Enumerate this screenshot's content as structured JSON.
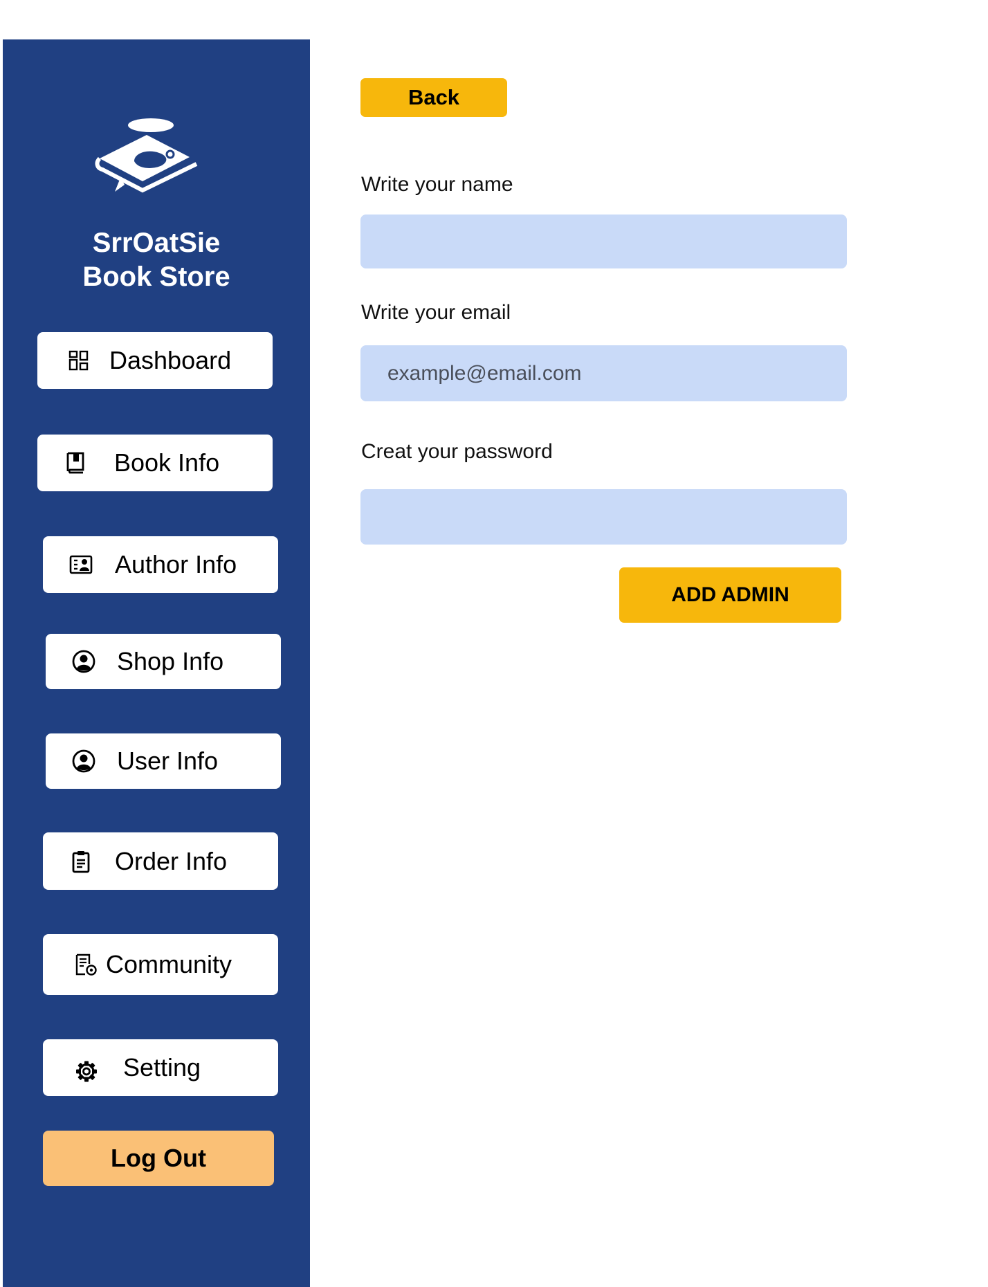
{
  "brand": {
    "line1": "SrrOatSie",
    "line2": "Book Store",
    "logo_icon": "book-with-cup-logo"
  },
  "sidebar": {
    "items": [
      {
        "label": "Dashboard",
        "icon": "dashboard-icon"
      },
      {
        "label": "Book Info",
        "icon": "book-icon"
      },
      {
        "label": "Author Info",
        "icon": "contact-card-icon"
      },
      {
        "label": "Shop Info",
        "icon": "user-circle-icon"
      },
      {
        "label": "User Info",
        "icon": "user-circle-icon"
      },
      {
        "label": "Order Info",
        "icon": "clipboard-icon"
      },
      {
        "label": "Community",
        "icon": "document-settings-icon"
      },
      {
        "label": "Setting",
        "icon": "gear-icon"
      }
    ],
    "logout_label": "Log Out"
  },
  "form": {
    "back_label": "Back",
    "name_label": "Write your name",
    "name_value": "",
    "email_label": "Write your email",
    "email_placeholder": "example@email.com",
    "password_label": "Creat your password",
    "password_value": "",
    "submit_label": "ADD ADMIN"
  },
  "colors": {
    "sidebar_bg": "#204082",
    "accent": "#f7b70c",
    "logout_bg": "#fac076",
    "input_bg": "#c9daf8"
  }
}
